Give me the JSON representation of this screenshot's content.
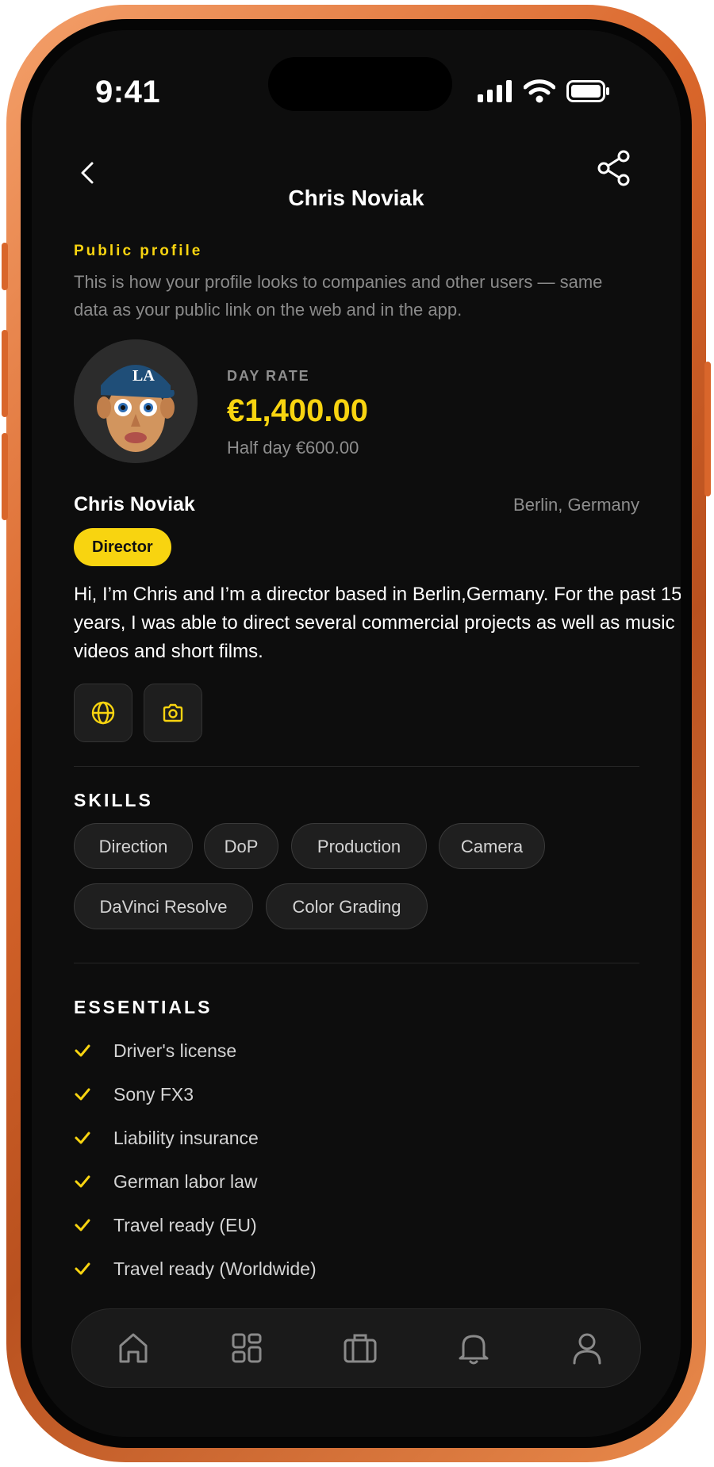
{
  "status_bar": {
    "time": "9:41"
  },
  "header": {
    "title": "Chris Noviak"
  },
  "intro": {
    "eyebrow": "Public profile",
    "text": "This is how your profile looks to companies and other users — same data as your public link on the web and in the app."
  },
  "rate": {
    "label": "DAY RATE",
    "value": "€1,400.00",
    "half_day": "Half day €600.00"
  },
  "profile": {
    "name": "Chris Noviak",
    "location": "Berlin, Germany",
    "role": "Director",
    "bio": "Hi, I’m Chris and I’m a director based in Berlin,Germany. For the past 15 years, I was able to direct several commercial projects as well as music videos and short films."
  },
  "links": [
    {
      "icon": "globe-icon"
    },
    {
      "icon": "camera-icon"
    }
  ],
  "skills": {
    "title": "SKILLS",
    "items": [
      "Direction",
      "DoP",
      "Production",
      "Camera",
      "DaVinci Resolve",
      "Color Grading"
    ]
  },
  "essentials": {
    "title": "ESSENTIALS",
    "items": [
      "Driver's license",
      "Sony FX3",
      "Liability insurance",
      "German labor law",
      "Travel ready (EU)",
      "Travel ready (Worldwide)"
    ]
  },
  "tabbar": {
    "items": [
      {
        "icon": "home-icon"
      },
      {
        "icon": "grid-icon"
      },
      {
        "icon": "briefcase-icon"
      },
      {
        "icon": "bell-icon"
      },
      {
        "icon": "user-icon"
      }
    ]
  },
  "colors": {
    "accent": "#F8D410",
    "background": "#0D0D0D",
    "frame": "#D9662B"
  }
}
